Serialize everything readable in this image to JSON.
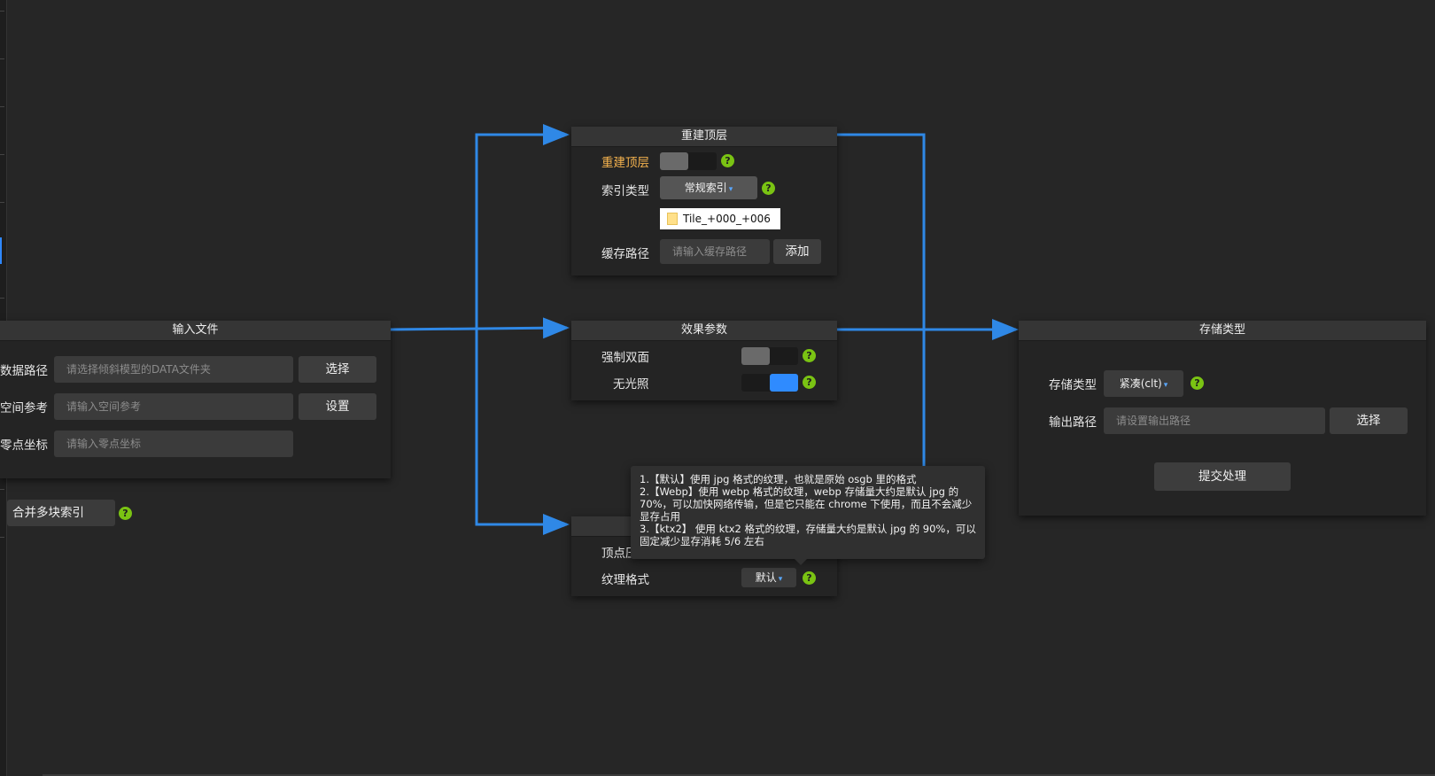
{
  "canvas": {
    "link_color": "#2f88e6"
  },
  "input_node": {
    "title": "输入文件",
    "data_path_label": "数据路径",
    "data_path_placeholder": "请选择倾斜模型的DATA文件夹",
    "select_label": "选择",
    "spatial_ref_label": "空间参考",
    "spatial_ref_placeholder": "请输入空间参考",
    "set_label": "设置",
    "zero_point_label": "零点坐标",
    "zero_point_placeholder": "请输入零点坐标"
  },
  "merge_option": {
    "label": "合并多块索引",
    "help": "?"
  },
  "rebuild_node": {
    "title": "重建顶层",
    "rebuild_label": "重建顶层",
    "rebuild_toggle_on": false,
    "index_type_label": "索引类型",
    "index_type_value": "常规索引",
    "tile_item": "Tile_+000_+006",
    "cache_path_label": "缓存路径",
    "cache_path_placeholder": "请输入缓存路径",
    "add_label": "添加",
    "help": "?"
  },
  "effect_node": {
    "title": "效果参数",
    "double_side_label": "强制双面",
    "double_side_on": false,
    "no_light_label": "无光照",
    "no_light_on": true,
    "help": "?"
  },
  "texture_node": {
    "vertex_label": "顶点压缩",
    "texture_format_label": "纹理格式",
    "texture_format_value": "默认",
    "help": "?"
  },
  "tooltip": {
    "line1": "1.【默认】使用 jpg 格式的纹理，也就是原始 osgb 里的格式",
    "line2": "2.【Webp】使用 webp 格式的纹理，webp 存储量大约是默认 jpg 的 70%，可以加快网络传输，但是它只能在 chrome 下使用，而且不会减少显存占用",
    "line3": "3.【ktx2】 使用 ktx2 格式的纹理，存储量大约是默认 jpg 的 90%，可以固定减少显存消耗 5/6 左右"
  },
  "storage_node": {
    "title": "存储类型",
    "storage_type_label": "存储类型",
    "storage_type_value": "紧凑(clt)",
    "output_path_label": "输出路径",
    "output_path_placeholder": "请设置输出路径",
    "select_label": "选择",
    "submit_label": "提交处理",
    "help": "?"
  }
}
